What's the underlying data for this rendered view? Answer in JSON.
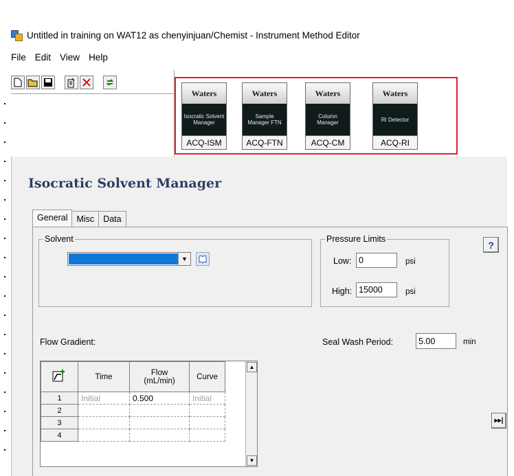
{
  "window": {
    "title": "Untitled in training on WAT12 as chenyinjuan/Chemist - Instrument Method Editor"
  },
  "menu": [
    "File",
    "Edit",
    "View",
    "Help"
  ],
  "toolbar": {
    "buttons": [
      "new-file-icon",
      "open-folder-icon",
      "save-disk-icon",
      "properties-icon",
      "delete-x-icon",
      "refresh-icon"
    ]
  },
  "modules": [
    {
      "brand": "Waters",
      "text": "Isocratic Solvent Manager",
      "label": "ACQ-ISM"
    },
    {
      "brand": "Waters",
      "text": "Sample Manager FTN",
      "label": "ACQ-FTN"
    },
    {
      "brand": "Waters",
      "text": "Column Manager",
      "label": "ACQ-CM"
    },
    {
      "brand": "Waters",
      "text": "RI Detector",
      "label": "ACQ-RI"
    }
  ],
  "page": {
    "heading": "Isocratic Solvent Manager",
    "tabs": [
      "General",
      "Misc",
      "Data"
    ],
    "solvent": {
      "legend": "Solvent",
      "value": ""
    },
    "pressure": {
      "legend": "Pressure Limits",
      "low_label": "Low:",
      "low_value": "0",
      "low_unit": "psi",
      "high_label": "High:",
      "high_value": "15000",
      "high_unit": "psi"
    },
    "help_label": "?",
    "flow_gradient_label": "Flow Gradient:",
    "seal_wash": {
      "label": "Seal Wash Period:",
      "value": "5.00",
      "unit": "min"
    },
    "grid": {
      "headers": {
        "time": "Time",
        "flow_line1": "Flow",
        "flow_line2": "(mL/min)",
        "curve": "Curve"
      },
      "rows": [
        {
          "n": "1",
          "time": "Initial",
          "flow": "0.500",
          "curve": "Initial"
        },
        {
          "n": "2",
          "time": "",
          "flow": "",
          "curve": ""
        },
        {
          "n": "3",
          "time": "",
          "flow": "",
          "curve": ""
        },
        {
          "n": "4",
          "time": "",
          "flow": "",
          "curve": ""
        }
      ]
    },
    "forward_button": "▸▸|"
  },
  "colors": {
    "highlight_box": "#e0202a",
    "heading": "#2b3f66",
    "selection": "#0f78d8"
  }
}
